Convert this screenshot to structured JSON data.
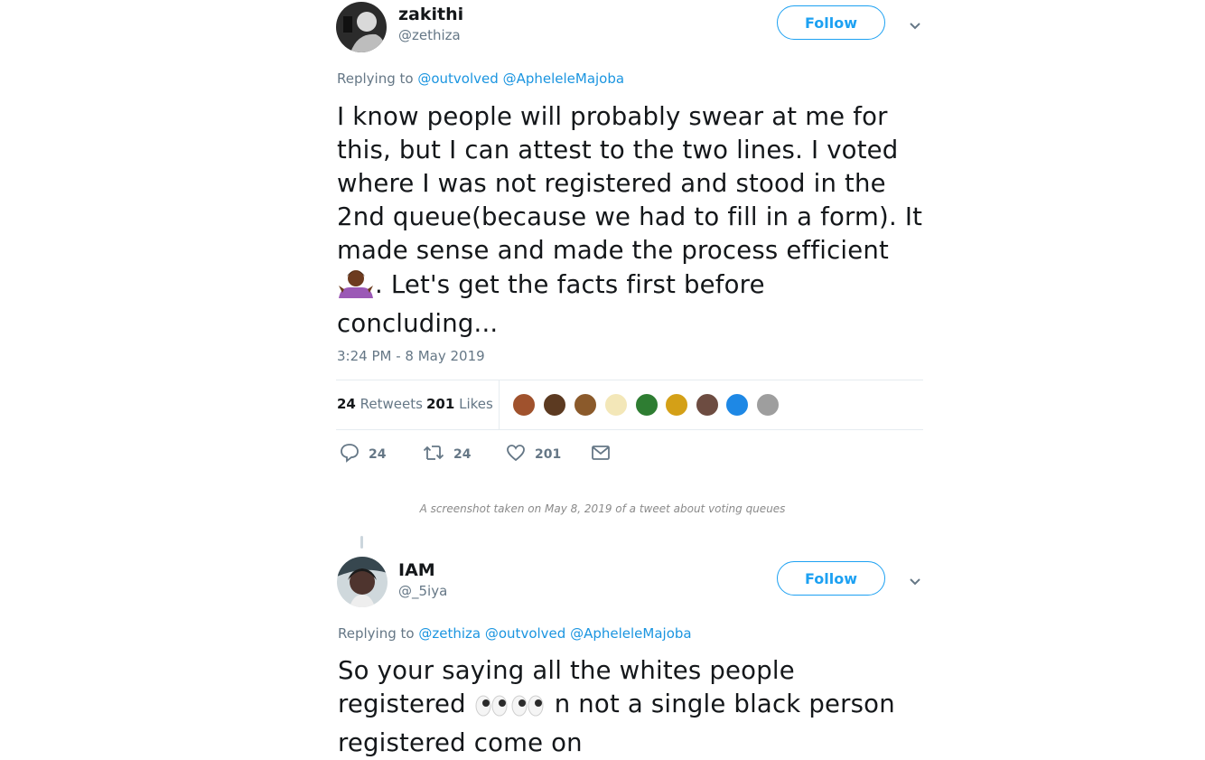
{
  "tweet1": {
    "display_name": "zakithi",
    "handle": "@zethiza",
    "follow_label": "Follow",
    "replying_prefix": "Replying to",
    "mentions": [
      "@outvolved",
      "@ApheleleMajoba"
    ],
    "text_lines": [
      "I know people will probably swear at me for",
      "this, but I can attest to the two lines. I voted",
      "where I was not registered and stood in the",
      "2nd queue(because we had to fill in a form). It",
      "made sense and made the process efficient",
      ". Let's get the facts first before",
      "concluding..."
    ],
    "timestamp": "3:24 PM - 8 May 2019",
    "retweets_count": "24",
    "retweets_label": "Retweets",
    "likes_count": "201",
    "likes_label": "Likes",
    "reply_count": "24",
    "retweet_count": "24",
    "like_count": "201",
    "liker_colors": [
      "#a0522d",
      "#5c3a21",
      "#8b5a2b",
      "#c8b560",
      "#2e7d32",
      "#d4a017",
      "#6d4c41",
      "#1e88e5",
      "#9e9e9e"
    ]
  },
  "caption": "A screenshot taken on May 8, 2019 of a tweet about voting queues",
  "tweet2": {
    "display_name": "IAM",
    "handle": "@_5iya",
    "follow_label": "Follow",
    "replying_prefix": "Replying to",
    "mentions": [
      "@zethiza",
      "@outvolved",
      "@ApheleleMajoba"
    ],
    "text_line1": "So your saying all the whites people",
    "text_line2a": "registered",
    "text_line2b": "n not a single black person",
    "text_line3": "registered come on"
  },
  "colors": {
    "accent": "#1da1f2",
    "mention": "#1b95e0",
    "muted": "#657786",
    "text": "#14171a",
    "border": "#e6ecf0"
  },
  "icons": [
    "chevron-down-icon",
    "reply-icon",
    "retweet-icon",
    "like-icon",
    "message-icon",
    "shrug-emoji",
    "eyes-emoji"
  ]
}
